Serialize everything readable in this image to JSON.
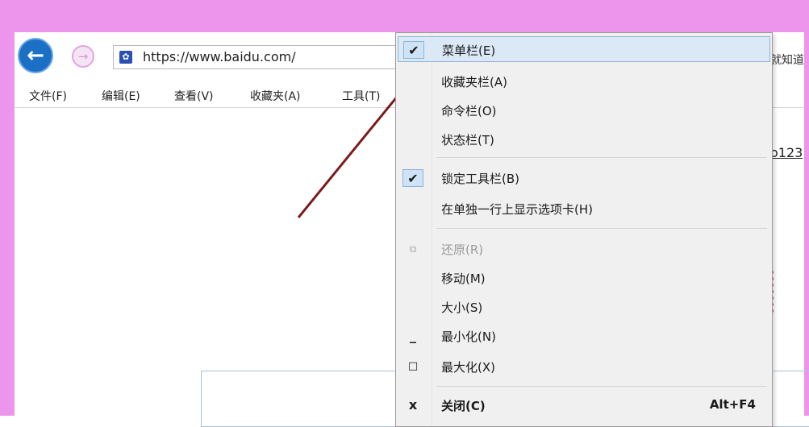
{
  "browser": {
    "url": "https://www.baidu.com/",
    "tab_fragment": "就知道",
    "page_fragment": "o123",
    "menubar": [
      "文件(F)",
      "编辑(E)",
      "查看(V)",
      "收藏夹(A)",
      "工具(T)"
    ],
    "icons": {
      "back": "back-arrow-icon",
      "forward": "forward-arrow-icon",
      "favicon": "baidu-paw-icon"
    }
  },
  "context_menu": {
    "items": [
      {
        "label": "菜单栏(E)",
        "checked": true,
        "highlighted": true
      },
      {
        "label": "收藏夹栏(A)"
      },
      {
        "label": "命令栏(O)"
      },
      {
        "label": "状态栏(T)"
      },
      {
        "label": "锁定工具栏(B)",
        "checked": true
      },
      {
        "label": "在单独一行上显示选项卡(H)"
      },
      {
        "label": "还原(R)",
        "disabled": true,
        "icon": "restore-icon"
      },
      {
        "label": "移动(M)"
      },
      {
        "label": "大小(S)"
      },
      {
        "label": "最小化(N)",
        "icon": "minimize-icon"
      },
      {
        "label": "最大化(X)",
        "icon": "maximize-icon"
      },
      {
        "label": "关闭(C)",
        "icon": "close-icon",
        "shortcut": "Alt+F4"
      }
    ]
  },
  "colors": {
    "frame": "#ed95ed",
    "highlight": "#dbe9f7",
    "arrow": "#7a1c1c",
    "back_button": "#1b6fc4"
  }
}
